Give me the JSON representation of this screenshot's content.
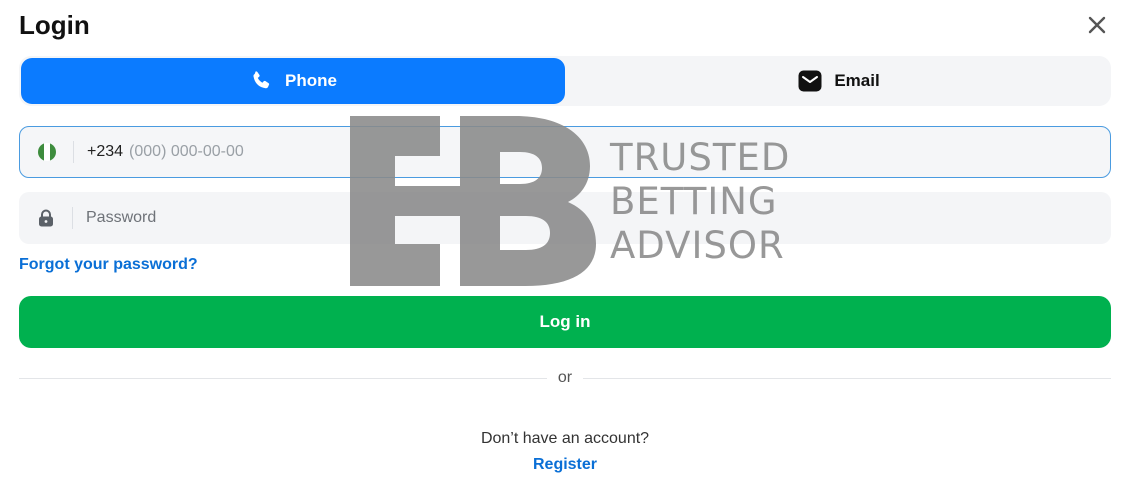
{
  "header": {
    "title": "Login"
  },
  "tabs": [
    {
      "label": "Phone",
      "icon": "phone-icon",
      "active": true
    },
    {
      "label": "Email",
      "icon": "email-icon",
      "active": false
    }
  ],
  "phone_field": {
    "country": "Nigeria",
    "flag_colors": [
      "#3d8c3d",
      "#ffffff",
      "#3d8c3d"
    ],
    "prefix": "+234",
    "placeholder": "(000) 000-00-00",
    "value": ""
  },
  "password_field": {
    "placeholder": "Password",
    "value": ""
  },
  "forgot_label": "Forgot your password?",
  "login_button": "Log in",
  "divider_text": "or",
  "signup": {
    "prompt": "Don’t have an account?",
    "link": "Register"
  },
  "watermark": {
    "lines": [
      "TRUSTED",
      "BETTING",
      "ADVISOR"
    ]
  },
  "colors": {
    "accent": "#0b7bff",
    "login_green": "#00b14f",
    "link_blue": "#0a6fd6"
  }
}
